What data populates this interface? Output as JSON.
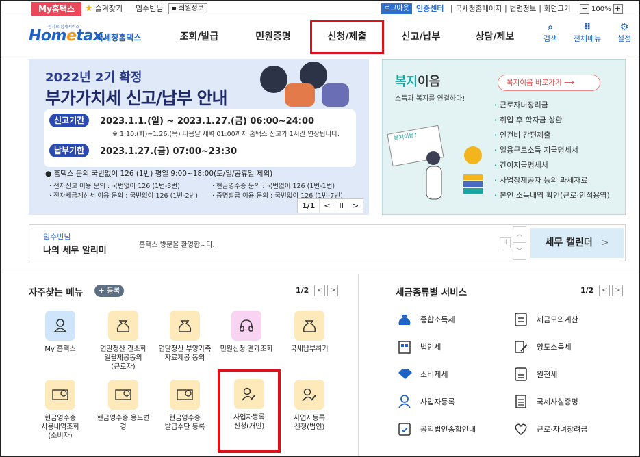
{
  "topbar": {
    "myhome": "My홈택스",
    "favorites": "즐겨찾기",
    "username": "임수빈님",
    "member_info": "회원정보",
    "logout": "로그아웃",
    "cert_center": "인증센터",
    "links": [
      "|",
      "국세청홈페이지",
      "|",
      "법령정보",
      "|",
      "화면크기"
    ],
    "zoom_minus": "−",
    "zoom_value": "100%",
    "zoom_plus": "+"
  },
  "header": {
    "logo_small": "전자로 납세서비스",
    "logo_main_pre": "Hom",
    "logo_main_e": "e",
    "logo_main_post": "tax.",
    "logo_sub": "국세청홈택스",
    "nav": [
      "조회/발급",
      "민원증명",
      "신청/제출",
      "신고/납부",
      "상담/제보"
    ],
    "nav_highlighted": "신청/제출",
    "icons": [
      {
        "glyph": "⌕",
        "label": "검색"
      },
      {
        "glyph": "⠿",
        "label": "전체메뉴"
      },
      {
        "glyph": "⚙",
        "label": "설정"
      }
    ]
  },
  "banner": {
    "year": "2022년 2기 확정",
    "title": "부가가치세 신고/납부 안내",
    "pill1": "신고기간",
    "period1": "2023.1.1.(일) ~ 2023.1.27.(금) 06:00~24:00",
    "note": "※ 1.10.(화)~1.26.(목) 다음날 새벽 01:00까지 홈택스 신고가 1시간 연장됩니다.",
    "pill2": "납부기한",
    "period2": "2023.1.27.(금) 07:00~23:30",
    "info": "● 홈택스 문의 국번없이 126 (1번) 평일 9:00~18:00(토/일/공휴일 제외)",
    "sub1": "· 전자신고 이용 문의 : 국번없이 126 (1번-3번)",
    "sub2": "· 현금영수증 문의 : 국번없이 126 (1번-1번)",
    "sub3": "· 전자세금계산서 이용 문의 : 국번없이 126 (1번-2번)",
    "sub4": "· 증명발급 이용 문의 : 국번없이 126 (1번-7번)",
    "page": "1/1",
    "prev": "<",
    "pause": "II",
    "next": ">"
  },
  "welfare": {
    "title_colored": "복지",
    "title_rest": "이음",
    "subtitle": "소득과 복지를 연결하다!",
    "link": "복지이음 바로가기  ⟶",
    "board_text": "복지이음?",
    "items": [
      "근로자녀장려금",
      "취업 후 학자금 상환",
      "인건비 간편제출",
      "일용근로소득 지급명세서",
      "간이지급명세서",
      "사업장제공자 등의 과세자료",
      "본인 소득내역 확인(근로·인적용역)"
    ]
  },
  "notice": {
    "user": "임수빈님",
    "title": "나의 세무 알리미",
    "message": "홈택스 방문을 환영합니다.",
    "pause": "II",
    "up": "︿",
    "down": "﹀",
    "calendar": "세무 캘린더",
    "calendar_arrow": ">"
  },
  "quick_menu": {
    "title": "자주찾는 메뉴",
    "add": "+ 등록",
    "page": "1/2",
    "prev": "<",
    "next": ">",
    "items": [
      {
        "label": "My 홈택스",
        "icon": "user-icon"
      },
      {
        "label": "연말정산 간소화\n일괄제공동의\n(근로자)",
        "icon": "money-bag-icon"
      },
      {
        "label": "연말정산 부양가족\n자료제공 동의",
        "icon": "money-bag-icon"
      },
      {
        "label": "민원신청 결과조회",
        "icon": "headset-icon"
      },
      {
        "label": "국세납부하기",
        "icon": "money-bag-icon"
      },
      {
        "label": "현금영수증\n사용내역조회\n(소비자)",
        "icon": "receipt-icon"
      },
      {
        "label": "현금영수증 용도변\n경",
        "icon": "receipt-icon"
      },
      {
        "label": "현금영수증\n발급수단 등록",
        "icon": "receipt-icon"
      },
      {
        "label": "사업자등록\n신청(개인)",
        "icon": "user-edit-icon"
      },
      {
        "label": "사업자등록\n신청(법인)",
        "icon": "user-edit-icon"
      }
    ]
  },
  "tax_services": {
    "title": "세금종류별 서비스",
    "page": "1/2",
    "prev": "<",
    "next": ">",
    "items": [
      "종합소득세",
      "세금모의계산",
      "법인세",
      "양도소득세",
      "소비제세",
      "원천세",
      "사업자등록",
      "국세사실증명",
      "공익법인종합안내",
      "근로·자녀장려금"
    ]
  },
  "colors": {
    "brand_blue": "#1f63c4",
    "highlight_red": "#e0101a",
    "myhome_red": "#e8485a",
    "welfare_teal": "#1aa5a0"
  }
}
